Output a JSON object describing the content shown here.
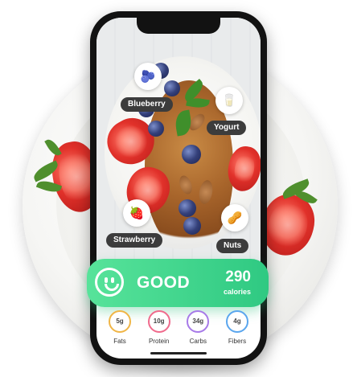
{
  "food_labels": [
    {
      "id": "blueberry",
      "label": "Blueberry",
      "icon": "blueberry-icon"
    },
    {
      "id": "yogurt",
      "label": "Yogurt",
      "icon": "yogurt-icon"
    },
    {
      "id": "strawberry",
      "label": "Strawberry",
      "icon": "strawberry-icon"
    },
    {
      "id": "nuts",
      "label": "Nuts",
      "icon": "nuts-icon"
    }
  ],
  "rating": {
    "status": "GOOD",
    "calories_value": "290",
    "calories_unit": "calories",
    "icon": "happy-face-icon"
  },
  "macros": [
    {
      "value": "5g",
      "label": "Fats",
      "color": "#f0b546",
      "progress": 0.35
    },
    {
      "value": "10g",
      "label": "Protein",
      "color": "#f06a8c",
      "progress": 0.5
    },
    {
      "value": "34g",
      "label": "Carbs",
      "color": "#a77ae8",
      "progress": 0.7
    },
    {
      "value": "4g",
      "label": "Fibers",
      "color": "#5aa6ee",
      "progress": 0.3
    }
  ],
  "colors": {
    "accent_green": "#3fd68b",
    "label_pill": "#3c3c3c"
  }
}
